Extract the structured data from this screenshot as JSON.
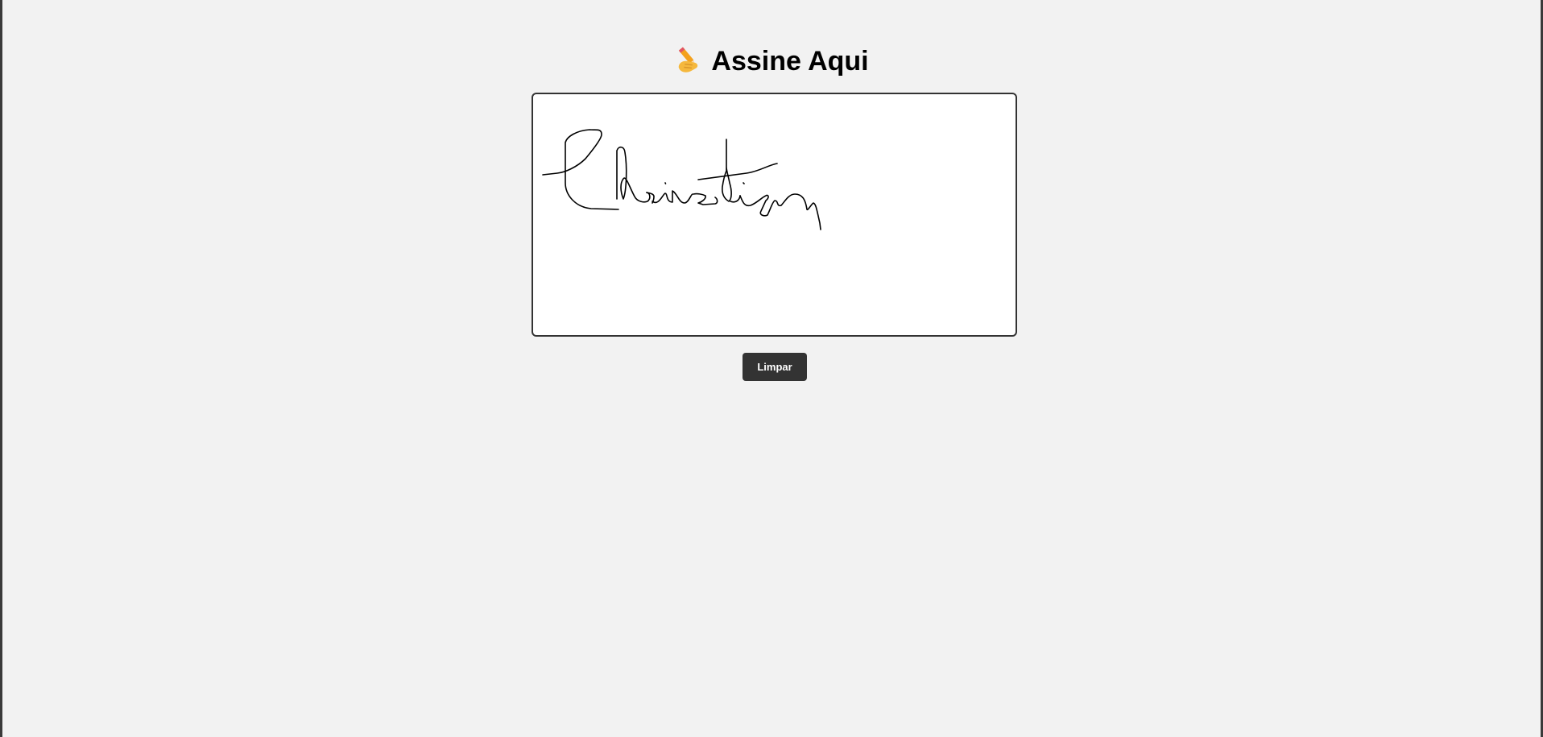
{
  "header": {
    "title_emoji_icon": "writing-hand-icon",
    "title": "Assine Aqui"
  },
  "signature_pad": {
    "state": "signed",
    "ink_color": "#000000"
  },
  "actions": {
    "clear_label": "Limpar"
  },
  "colors": {
    "background": "#f2f2f2",
    "button_bg": "#333333",
    "button_text": "#ffffff",
    "pad_border": "#333333"
  }
}
